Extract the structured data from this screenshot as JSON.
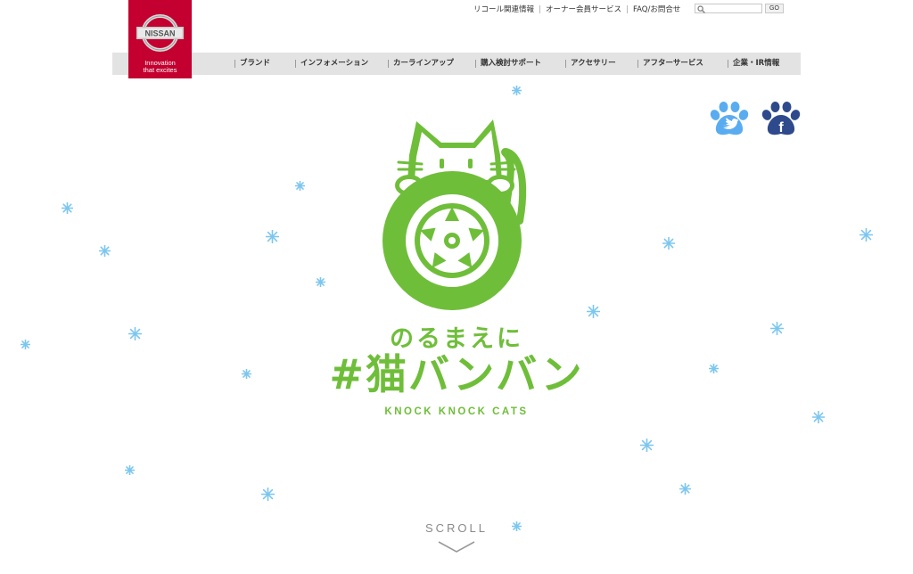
{
  "brand": {
    "name": "NISSAN",
    "tagline_line1": "Innovation",
    "tagline_line2": "that excites",
    "color": "#c3002f"
  },
  "utility_links": [
    "リコール関連情報",
    "オーナー会員サービス",
    "FAQ/お問合せ"
  ],
  "search": {
    "placeholder": "",
    "button_label": "GO"
  },
  "nav": {
    "items": [
      "ブランド",
      "インフォメーション",
      "カーラインアップ",
      "購入検討サポート",
      "アクセサリー",
      "アフターサービス",
      "企業・IR情報"
    ]
  },
  "social": {
    "twitter_icon": "twitter-paw-icon",
    "facebook_icon": "facebook-paw-icon",
    "twitter_color": "#5aacf0",
    "facebook_color": "#2e4a8c",
    "facebook_letter": "f"
  },
  "hero": {
    "line1": "のるまえに",
    "line2": "#猫バンバン",
    "subtitle": "KNOCK KNOCK CATS",
    "color": "#6fbe3a",
    "icon": "cat-on-tire-icon"
  },
  "scroll": {
    "label": "SCROLL",
    "icon": "chevron-down-icon"
  },
  "decor": {
    "snowflake_color": "#7cc6ef",
    "icon": "snowflake-icon"
  }
}
